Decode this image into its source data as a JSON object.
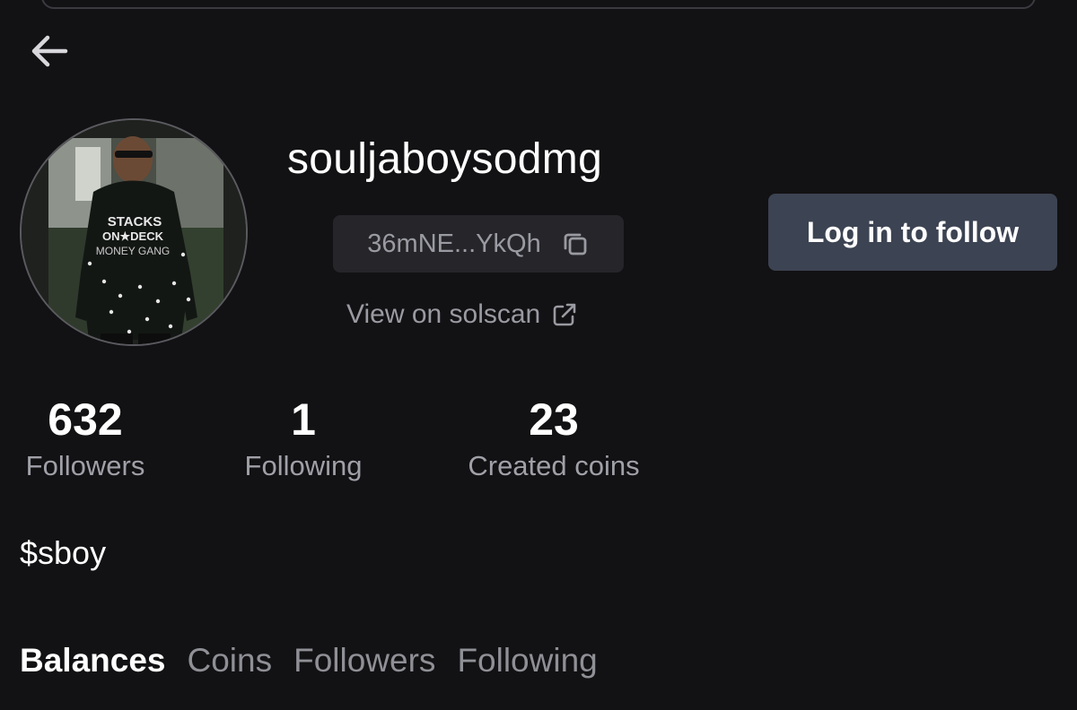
{
  "profile": {
    "username": "souljaboysodmg",
    "address_short": "36mNE...YkQh",
    "solscan_label": "View on solscan",
    "ticker": "$sboy"
  },
  "actions": {
    "follow_label": "Log in to follow"
  },
  "stats": {
    "followers": {
      "value": "632",
      "label": "Followers"
    },
    "following": {
      "value": "1",
      "label": "Following"
    },
    "created": {
      "value": "23",
      "label": "Created coins"
    }
  },
  "tabs": [
    {
      "label": "Balances",
      "active": true
    },
    {
      "label": "Coins",
      "active": false
    },
    {
      "label": "Followers",
      "active": false
    },
    {
      "label": "Following",
      "active": false
    }
  ],
  "icons": {
    "back": "arrow-left-icon",
    "copy": "copy-icon",
    "external": "external-link-icon"
  },
  "colors": {
    "background": "#121113",
    "follow_button": "#3c4352",
    "chip": "#25252a",
    "muted_text": "#9a9aa2"
  }
}
